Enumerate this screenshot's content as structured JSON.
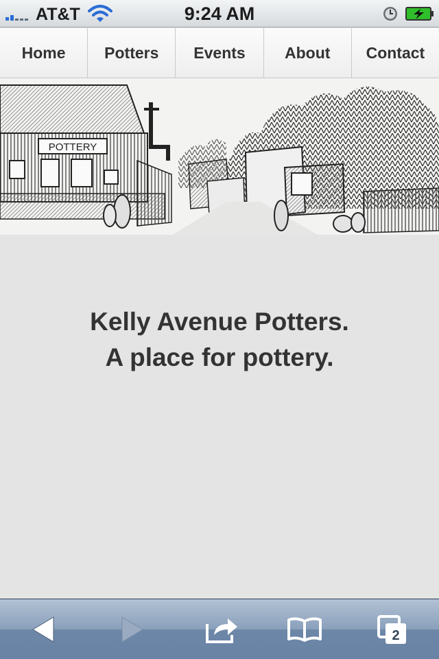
{
  "status_bar": {
    "carrier": "AT&T",
    "time": "9:24 AM",
    "icons": [
      "signal-icon",
      "wifi-icon",
      "alarm-icon",
      "battery-charging-icon"
    ]
  },
  "nav": {
    "items": [
      {
        "label": "Home"
      },
      {
        "label": "Potters"
      },
      {
        "label": "Events"
      },
      {
        "label": "About"
      },
      {
        "label": "Contact"
      }
    ]
  },
  "banner": {
    "sign_text": "POTTERY"
  },
  "main": {
    "headline_line1": "Kelly Avenue Potters.",
    "headline_line2": "A place for pottery."
  },
  "toolbar": {
    "icons": [
      "back-icon",
      "forward-icon",
      "share-icon",
      "bookmarks-icon",
      "tabs-icon"
    ],
    "tabs_count": "2"
  }
}
